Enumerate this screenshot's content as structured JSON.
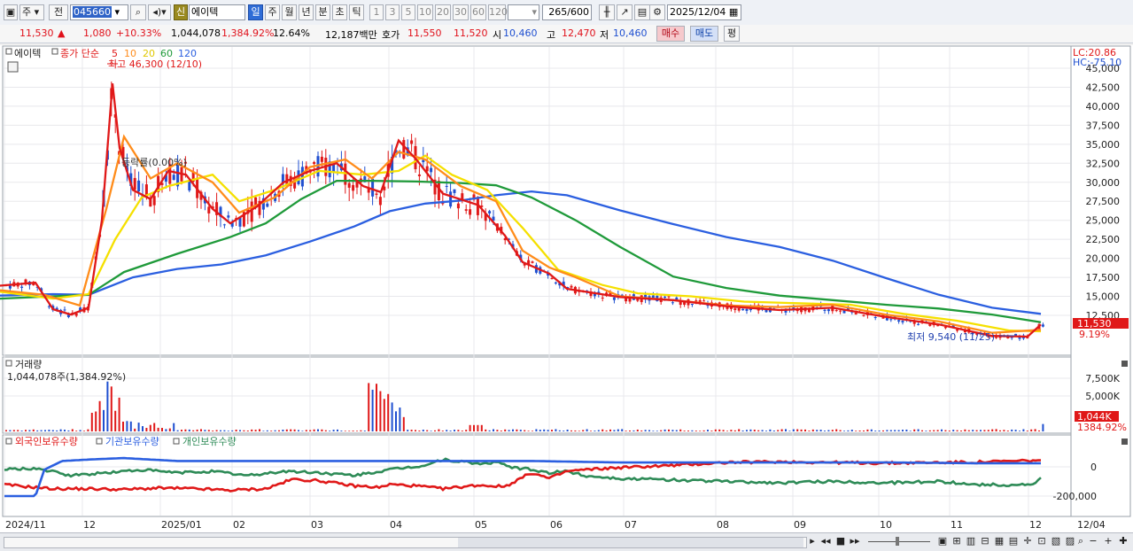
{
  "toolbar": {
    "period_mode": "주",
    "prev_label": "전",
    "code": "045660",
    "credit_badge": "신",
    "stock_name": "에이텍",
    "periods": [
      "일",
      "주",
      "월",
      "년",
      "분",
      "초",
      "틱"
    ],
    "active_period": "일",
    "intervals": [
      "1",
      "3",
      "5",
      "10",
      "20",
      "30",
      "60",
      "120"
    ],
    "count": "265",
    "count_total": "/600",
    "date": "2025/12/04"
  },
  "quote": {
    "price": "11,530",
    "direction": "▲",
    "change": "1,080",
    "change_pct": "+10.33%",
    "volume": "1,044,078",
    "volume_ratio": "1,384.92%",
    "turnover": "12.64%",
    "amount": "12,187백만",
    "ask_label": "호가",
    "ask": "11,550",
    "bid": "11,520",
    "open_label": "시",
    "open": "10,460",
    "high_label": "고",
    "high": "12,470",
    "low_label": "저",
    "low": "10,460",
    "buy_label": "매수",
    "sell_label": "매도",
    "avg_label": "평"
  },
  "price_panel": {
    "name": "에이텍",
    "legend_label": "종가 단순",
    "ma": [
      {
        "period": "5",
        "color": "#e01818"
      },
      {
        "period": "10",
        "color": "#ff8c1a"
      },
      {
        "period": "20",
        "color": "#f5e000"
      },
      {
        "period": "60",
        "color": "#1f9a3a"
      },
      {
        "period": "120",
        "color": "#2b5fe0"
      }
    ],
    "high_marker": "최고 46,300 (12/10)",
    "low_marker": "최저 9,540 (11/25)",
    "rate_label": "등락률(0.00%)",
    "lc": "LC:20.86",
    "hc": "HC:-75.10",
    "y_ticks": [
      "45,000",
      "42,500",
      "40,000",
      "37,500",
      "35,000",
      "32,500",
      "30,000",
      "27,500",
      "25,000",
      "22,500",
      "20,000",
      "17,500",
      "15,000",
      "12,500"
    ],
    "current_price": "11,530",
    "current_pct": "9.19%"
  },
  "volume_panel": {
    "title": "거래량",
    "value": "1,044,078주(1,384.92%)",
    "y_ticks": [
      "7,500K",
      "5,000K"
    ],
    "current": "1,044K",
    "current_pct": "1384.92%"
  },
  "holders_panel": {
    "labels": [
      "외국인보유수량",
      "기관보유수량",
      "개인보유수량"
    ],
    "colors": [
      "#e01818",
      "#2b5fe0",
      "#2e8b57"
    ],
    "y_ticks": [
      "0",
      "-200,000"
    ]
  },
  "x_axis": {
    "labels": [
      "2024/11",
      "12",
      "2025/01",
      "02",
      "03",
      "04",
      "05",
      "06",
      "07",
      "08",
      "09",
      "10",
      "11",
      "12"
    ],
    "corner_label": "12/04"
  },
  "chart_data": {
    "type": "candlestick",
    "price_scale": [
      9000,
      46000
    ],
    "ma_series": {
      "ma120": [
        [
          0,
          15100
        ],
        [
          30,
          15200
        ],
        [
          60,
          15300
        ],
        [
          100,
          15200
        ],
        [
          150,
          17500
        ],
        [
          200,
          18600
        ],
        [
          250,
          19200
        ],
        [
          300,
          20400
        ],
        [
          350,
          22200
        ],
        [
          400,
          24200
        ],
        [
          440,
          26200
        ],
        [
          480,
          27200
        ],
        [
          520,
          27600
        ],
        [
          560,
          28300
        ],
        [
          600,
          28800
        ],
        [
          640,
          28300
        ],
        [
          700,
          26300
        ],
        [
          760,
          24500
        ],
        [
          820,
          22800
        ],
        [
          880,
          21500
        ],
        [
          940,
          19700
        ],
        [
          1000,
          17400
        ],
        [
          1060,
          15200
        ],
        [
          1120,
          13500
        ],
        [
          1175,
          12700
        ]
      ],
      "ma60": [
        [
          0,
          14700
        ],
        [
          40,
          14900
        ],
        [
          100,
          15200
        ],
        [
          140,
          18200
        ],
        [
          200,
          20600
        ],
        [
          260,
          22800
        ],
        [
          300,
          24600
        ],
        [
          340,
          27800
        ],
        [
          380,
          30200
        ],
        [
          420,
          30200
        ],
        [
          470,
          30100
        ],
        [
          520,
          29900
        ],
        [
          560,
          29600
        ],
        [
          600,
          28000
        ],
        [
          650,
          25000
        ],
        [
          700,
          21500
        ],
        [
          760,
          17600
        ],
        [
          820,
          16100
        ],
        [
          880,
          15100
        ],
        [
          940,
          14500
        ],
        [
          1000,
          13900
        ],
        [
          1060,
          13400
        ],
        [
          1120,
          12600
        ],
        [
          1175,
          11600
        ]
      ],
      "ma20": [
        [
          0,
          15600
        ],
        [
          60,
          14700
        ],
        [
          100,
          15300
        ],
        [
          130,
          22500
        ],
        [
          160,
          28000
        ],
        [
          190,
          29500
        ],
        [
          240,
          31000
        ],
        [
          270,
          27500
        ],
        [
          310,
          29000
        ],
        [
          360,
          31500
        ],
        [
          410,
          31000
        ],
        [
          450,
          31500
        ],
        [
          480,
          33500
        ],
        [
          510,
          31000
        ],
        [
          550,
          29000
        ],
        [
          590,
          24000
        ],
        [
          630,
          18500
        ],
        [
          680,
          16500
        ],
        [
          720,
          15400
        ],
        [
          780,
          15000
        ],
        [
          840,
          14300
        ],
        [
          900,
          14100
        ],
        [
          960,
          13900
        ],
        [
          1020,
          12700
        ],
        [
          1080,
          11800
        ],
        [
          1140,
          10500
        ],
        [
          1175,
          10400
        ]
      ],
      "ma10": [
        [
          0,
          15800
        ],
        [
          50,
          15200
        ],
        [
          90,
          13800
        ],
        [
          120,
          26500
        ],
        [
          140,
          36000
        ],
        [
          170,
          30500
        ],
        [
          200,
          32500
        ],
        [
          240,
          30000
        ],
        [
          270,
          26000
        ],
        [
          310,
          28000
        ],
        [
          350,
          32000
        ],
        [
          390,
          33000
        ],
        [
          420,
          30500
        ],
        [
          450,
          34000
        ],
        [
          480,
          33000
        ],
        [
          520,
          29500
        ],
        [
          560,
          27500
        ],
        [
          590,
          21000
        ],
        [
          620,
          18800
        ],
        [
          650,
          17500
        ],
        [
          700,
          15000
        ],
        [
          760,
          14500
        ],
        [
          820,
          13800
        ],
        [
          880,
          13600
        ],
        [
          940,
          13900
        ],
        [
          1000,
          12600
        ],
        [
          1060,
          11700
        ],
        [
          1120,
          10200
        ],
        [
          1175,
          10600
        ]
      ],
      "ma5": [
        [
          0,
          16400
        ],
        [
          40,
          16800
        ],
        [
          60,
          13300
        ],
        [
          80,
          12600
        ],
        [
          100,
          13500
        ],
        [
          115,
          25000
        ],
        [
          127,
          43000
        ],
        [
          135,
          34500
        ],
        [
          150,
          29000
        ],
        [
          170,
          27800
        ],
        [
          190,
          31500
        ],
        [
          210,
          31000
        ],
        [
          240,
          26500
        ],
        [
          260,
          24600
        ],
        [
          290,
          26800
        ],
        [
          320,
          30000
        ],
        [
          350,
          31500
        ],
        [
          380,
          32500
        ],
        [
          410,
          29500
        ],
        [
          430,
          28700
        ],
        [
          450,
          35500
        ],
        [
          470,
          33000
        ],
        [
          500,
          28500
        ],
        [
          540,
          27000
        ],
        [
          570,
          23000
        ],
        [
          590,
          19500
        ],
        [
          620,
          18000
        ],
        [
          640,
          16000
        ],
        [
          700,
          14900
        ],
        [
          760,
          14500
        ],
        [
          820,
          13700
        ],
        [
          880,
          13200
        ],
        [
          940,
          13500
        ],
        [
          1000,
          12300
        ],
        [
          1060,
          11300
        ],
        [
          1120,
          9800
        ],
        [
          1160,
          9700
        ],
        [
          1175,
          11300
        ]
      ]
    },
    "holders": {
      "foreign": [
        [
          0,
          -120000
        ],
        [
          60,
          -150000
        ],
        [
          100,
          -150000
        ],
        [
          140,
          -155000
        ],
        [
          180,
          -145000
        ],
        [
          220,
          -150000
        ],
        [
          260,
          -160000
        ],
        [
          300,
          -150000
        ],
        [
          330,
          -85000
        ],
        [
          360,
          -95000
        ],
        [
          400,
          -130000
        ],
        [
          430,
          -140000
        ],
        [
          440,
          -120000
        ],
        [
          470,
          -130000
        ],
        [
          500,
          -150000
        ],
        [
          540,
          -125000
        ],
        [
          570,
          -135000
        ],
        [
          600,
          -40000
        ],
        [
          620,
          -80000
        ],
        [
          640,
          -30000
        ],
        [
          660,
          -20000
        ],
        [
          700,
          -5000
        ],
        [
          760,
          10000
        ],
        [
          820,
          30000
        ],
        [
          880,
          35000
        ],
        [
          940,
          30000
        ],
        [
          1000,
          25000
        ],
        [
          1060,
          30000
        ],
        [
          1100,
          32000
        ],
        [
          1150,
          40000
        ],
        [
          1175,
          45000
        ]
      ],
      "institution": [
        [
          0,
          -200000
        ],
        [
          40,
          -200000
        ],
        [
          50,
          -20000
        ],
        [
          70,
          40000
        ],
        [
          100,
          50000
        ],
        [
          140,
          60000
        ],
        [
          200,
          40000
        ],
        [
          300,
          40000
        ],
        [
          400,
          40000
        ],
        [
          500,
          40000
        ],
        [
          600,
          40000
        ],
        [
          700,
          30000
        ],
        [
          800,
          30000
        ],
        [
          900,
          30000
        ],
        [
          1000,
          30000
        ],
        [
          1100,
          25000
        ],
        [
          1175,
          25000
        ]
      ],
      "individual": [
        [
          0,
          -20000
        ],
        [
          40,
          -10000
        ],
        [
          80,
          -60000
        ],
        [
          120,
          -40000
        ],
        [
          160,
          -20000
        ],
        [
          200,
          -40000
        ],
        [
          240,
          -30000
        ],
        [
          280,
          -60000
        ],
        [
          320,
          -30000
        ],
        [
          360,
          -40000
        ],
        [
          400,
          -60000
        ],
        [
          440,
          -20000
        ],
        [
          480,
          10000
        ],
        [
          500,
          50000
        ],
        [
          540,
          20000
        ],
        [
          560,
          30000
        ],
        [
          580,
          -5000
        ],
        [
          600,
          -20000
        ],
        [
          620,
          -40000
        ],
        [
          640,
          -30000
        ],
        [
          660,
          -60000
        ],
        [
          700,
          -80000
        ],
        [
          760,
          -90000
        ],
        [
          820,
          -100000
        ],
        [
          880,
          -110000
        ],
        [
          940,
          -100000
        ],
        [
          1000,
          -110000
        ],
        [
          1060,
          -100000
        ],
        [
          1100,
          -120000
        ],
        [
          1140,
          -125000
        ],
        [
          1165,
          -120000
        ],
        [
          1175,
          -80000
        ]
      ]
    }
  }
}
